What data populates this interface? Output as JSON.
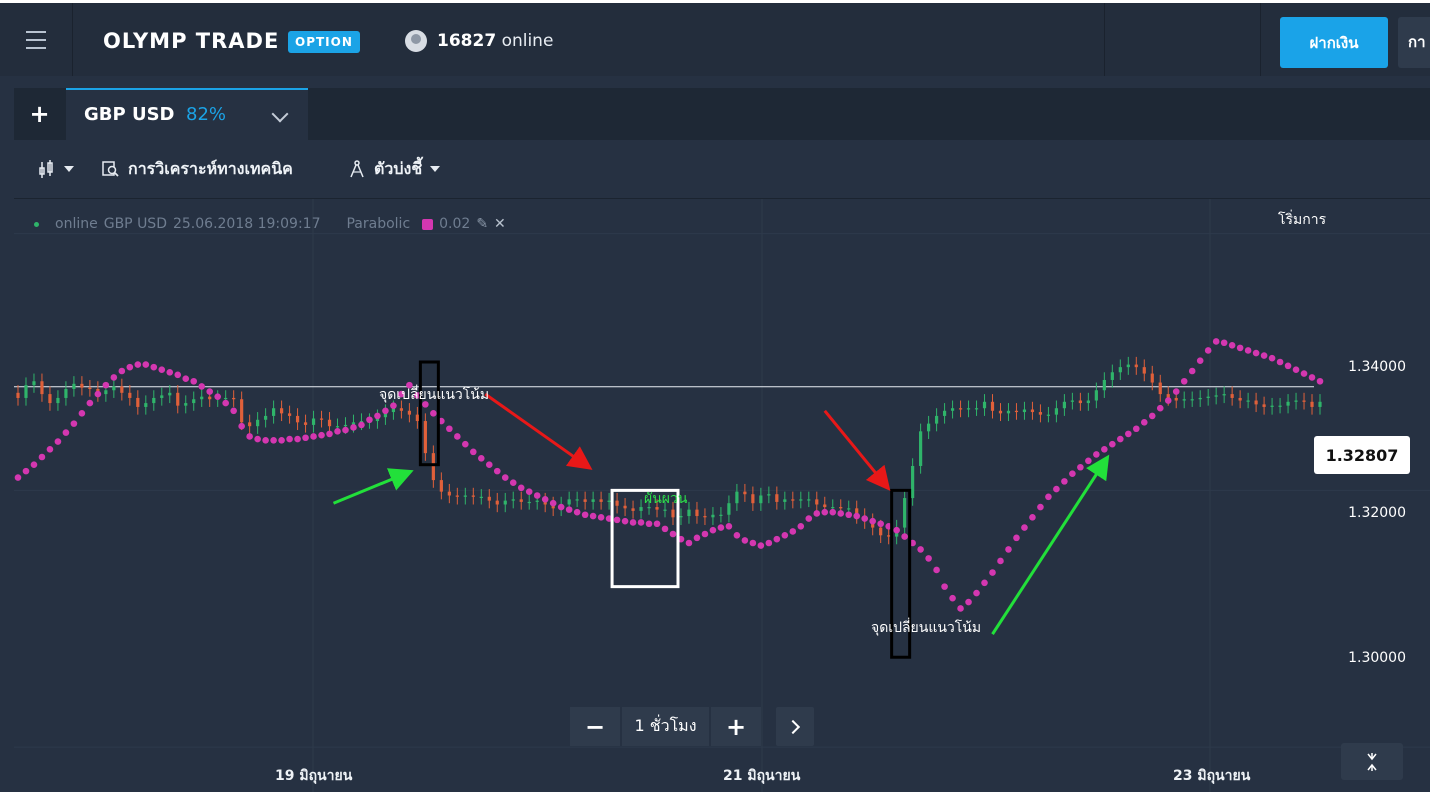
{
  "header": {
    "logo": "OLYMP TRADE",
    "badge": "OPTION",
    "online_count": "16827",
    "online_label": "online",
    "deposit_label": "ฝากเงิน",
    "trade_label_partial": "กา"
  },
  "tabs": {
    "add_label": "+",
    "asset_name": "GBP USD",
    "asset_payout": "82%"
  },
  "toolbar": {
    "analysis_label": "การวิเคราะห์ทางเทคนิค",
    "indicators_label": "ตัวบ่งชี้"
  },
  "legend": {
    "status": "online",
    "pair": "GBP USD",
    "datetime": "25.06.2018 19:09:17",
    "indicator": "Parabolic",
    "indicator_value": "0.02"
  },
  "chart_header_partial": "โริ่มการ",
  "price_tag": "1.32807",
  "annotations": {
    "reversal_1": "จุดเปลี่ยนแนวโน้ม",
    "reversal_2": "จุดเปลี่ยนแนวโน้ม",
    "sideways": "ผันผวน"
  },
  "zoom": {
    "minus": "−",
    "timeframe": "1 ชั่วโมง",
    "plus": "+"
  },
  "colors": {
    "accent": "#1ba3e6",
    "parabolic": "#d437b0",
    "bull": "#2fb46a",
    "bear": "#e0603a",
    "arrow_green": "#22e03a",
    "arrow_red": "#e81818"
  },
  "chart_data": {
    "type": "candlestick",
    "ylim": [
      1.2965,
      1.3427
    ],
    "y_ticks": [
      "1.34000",
      "1.32000",
      "1.30000"
    ],
    "y_tick_values": [
      1.34,
      1.32,
      1.3
    ],
    "current_price": 1.32807,
    "x_labels": [
      "19 มิถุนายน",
      "21 มิถุนายน",
      "23 มิถุนายน"
    ],
    "close": [
      1.3272,
      1.3282,
      1.3285,
      1.3275,
      1.3268,
      1.3272,
      1.3279,
      1.3283,
      1.328,
      1.3279,
      1.3275,
      1.3278,
      1.3281,
      1.3276,
      1.3272,
      1.3265,
      1.3268,
      1.3272,
      1.3274,
      1.3276,
      1.3266,
      1.3268,
      1.3271,
      1.3273,
      1.3271,
      1.3272,
      1.3272,
      1.3271,
      1.3253,
      1.325,
      1.3255,
      1.3258,
      1.3264,
      1.326,
      1.3258,
      1.3253,
      1.3251,
      1.3256,
      1.3255,
      1.325,
      1.325,
      1.3251,
      1.3253,
      1.3254,
      1.3254,
      1.3257,
      1.3261,
      1.3264,
      1.3262,
      1.3259,
      1.3254,
      1.3229,
      1.3208,
      1.3199,
      1.3196,
      1.3195,
      1.3196,
      1.3195,
      1.3195,
      1.3192,
      1.3189,
      1.3192,
      1.3193,
      1.3191,
      1.3191,
      1.3192,
      1.3189,
      1.3186,
      1.3189,
      1.3193,
      1.3193,
      1.3191,
      1.3193,
      1.3191,
      1.3192,
      1.3188,
      1.3186,
      1.3184,
      1.3187,
      1.3187,
      1.3185,
      1.3185,
      1.3179,
      1.318,
      1.3185,
      1.318,
      1.3179,
      1.3181,
      1.3181,
      1.319,
      1.3199,
      1.3197,
      1.319,
      1.3196,
      1.3197,
      1.3191,
      1.3193,
      1.3192,
      1.3193,
      1.3193,
      1.3189,
      1.3187,
      1.3187,
      1.3186,
      1.3186,
      1.318,
      1.3176,
      1.3171,
      1.3165,
      1.3164,
      1.3171,
      1.3194,
      1.3219,
      1.3246,
      1.3252,
      1.3258,
      1.3262,
      1.3264,
      1.3263,
      1.3264,
      1.3264,
      1.3269,
      1.3262,
      1.326,
      1.3262,
      1.3261,
      1.3263,
      1.3261,
      1.3259,
      1.3259,
      1.3264,
      1.3269,
      1.327,
      1.3268,
      1.327,
      1.3278,
      1.3286,
      1.3292,
      1.3296,
      1.3298,
      1.3296,
      1.3291,
      1.3284,
      1.3275,
      1.3272,
      1.327,
      1.3271,
      1.3271,
      1.3272,
      1.3273,
      1.3274,
      1.3275,
      1.3272,
      1.327,
      1.327,
      1.3267,
      1.3265,
      1.3266,
      1.3266,
      1.3269,
      1.327,
      1.3269,
      1.3265,
      1.3269
    ],
    "parabolic_sar": [
      1.321,
      1.3215,
      1.322,
      1.3226,
      1.3232,
      1.3238,
      1.3245,
      1.3252,
      1.326,
      1.3268,
      1.3275,
      1.3282,
      1.3288,
      1.3293,
      1.3296,
      1.3298,
      1.3298,
      1.3296,
      1.3294,
      1.3292,
      1.329,
      1.3287,
      1.3285,
      1.3281,
      1.3277,
      1.3273,
      1.3268,
      1.3262,
      1.325,
      1.3242,
      1.324,
      1.3239,
      1.3239,
      1.3239,
      1.324,
      1.324,
      1.3241,
      1.3242,
      1.3243,
      1.3244,
      1.3246,
      1.3247,
      1.3249,
      1.3251,
      1.3255,
      1.3258,
      1.3262,
      1.3266,
      1.3275,
      1.3282,
      1.3274,
      1.3267,
      1.326,
      1.3254,
      1.3248,
      1.3242,
      1.3236,
      1.323,
      1.3225,
      1.322,
      1.3215,
      1.321,
      1.3206,
      1.3202,
      1.3199,
      1.3196,
      1.3193,
      1.319,
      1.3187,
      1.3185,
      1.3183,
      1.3181,
      1.318,
      1.3179,
      1.3178,
      1.3177,
      1.3176,
      1.3175,
      1.3175,
      1.3174,
      1.3174,
      1.317,
      1.3166,
      1.3162,
      1.3159,
      1.3163,
      1.3166,
      1.3169,
      1.3171,
      1.3172,
      1.3165,
      1.3161,
      1.3159,
      1.3157,
      1.3159,
      1.3162,
      1.3165,
      1.3168,
      1.3172,
      1.3178,
      1.3182,
      1.3183,
      1.3183,
      1.3182,
      1.3181,
      1.318,
      1.3178,
      1.3176,
      1.3174,
      1.3172,
      1.3169,
      1.3164,
      1.3159,
      1.3154,
      1.3147,
      1.3138,
      1.3125,
      1.3116,
      1.3108,
      1.3113,
      1.312,
      1.3128,
      1.3136,
      1.3145,
      1.3154,
      1.3163,
      1.3171,
      1.3179,
      1.3187,
      1.3195,
      1.3201,
      1.3207,
      1.3213,
      1.3218,
      1.3223,
      1.3228,
      1.3232,
      1.3236,
      1.324,
      1.3244,
      1.3248,
      1.3253,
      1.3258,
      1.3264,
      1.327,
      1.3277,
      1.3285,
      1.3293,
      1.3301,
      1.3309,
      1.3316,
      1.3315,
      1.3313,
      1.3311,
      1.3309,
      1.3307,
      1.3305,
      1.3303,
      1.33,
      1.3297,
      1.3294,
      1.3291,
      1.3288,
      1.3285,
      1.3283,
      1.3281,
      1.328
    ]
  }
}
